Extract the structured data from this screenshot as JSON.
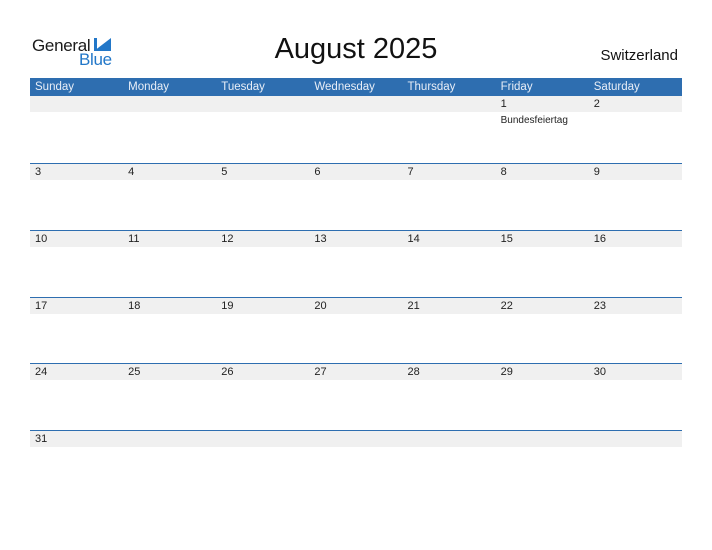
{
  "logo": {
    "word1": "General",
    "word2": "Blue",
    "icon": "triangle-flag-icon"
  },
  "title": "August 2025",
  "country": "Switzerland",
  "colors": {
    "header_bg": "#2e6eb0",
    "strip_bg": "#f0f0f0",
    "logo_blue": "#2277c8"
  },
  "weekdays": [
    "Sunday",
    "Monday",
    "Tuesday",
    "Wednesday",
    "Thursday",
    "Friday",
    "Saturday"
  ],
  "weeks": [
    {
      "days": [
        "",
        "",
        "",
        "",
        "",
        "1",
        "2"
      ],
      "holidays": [
        "",
        "",
        "",
        "",
        "",
        "Bundesfeiertag",
        ""
      ]
    },
    {
      "days": [
        "3",
        "4",
        "5",
        "6",
        "7",
        "8",
        "9"
      ],
      "holidays": [
        "",
        "",
        "",
        "",
        "",
        "",
        ""
      ]
    },
    {
      "days": [
        "10",
        "11",
        "12",
        "13",
        "14",
        "15",
        "16"
      ],
      "holidays": [
        "",
        "",
        "",
        "",
        "",
        "",
        ""
      ]
    },
    {
      "days": [
        "17",
        "18",
        "19",
        "20",
        "21",
        "22",
        "23"
      ],
      "holidays": [
        "",
        "",
        "",
        "",
        "",
        "",
        ""
      ]
    },
    {
      "days": [
        "24",
        "25",
        "26",
        "27",
        "28",
        "29",
        "30"
      ],
      "holidays": [
        "",
        "",
        "",
        "",
        "",
        "",
        ""
      ]
    },
    {
      "days": [
        "31",
        "",
        "",
        "",
        "",
        "",
        ""
      ],
      "holidays": [
        "",
        "",
        "",
        "",
        "",
        "",
        ""
      ]
    }
  ]
}
